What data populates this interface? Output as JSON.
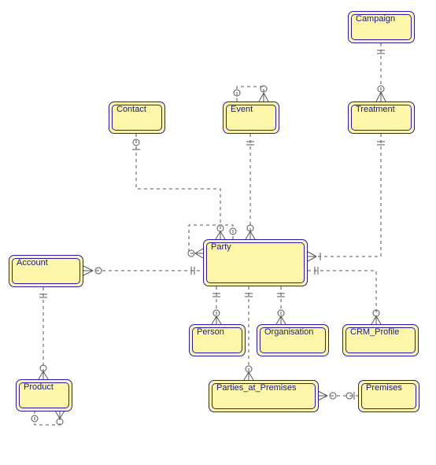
{
  "entities": {
    "campaign": {
      "label": "Campaign"
    },
    "contact": {
      "label": "Contact"
    },
    "event": {
      "label": "Event"
    },
    "treatment": {
      "label": "Treatment"
    },
    "account": {
      "label": "Account"
    },
    "party": {
      "label": "Party"
    },
    "person": {
      "label": "Person"
    },
    "organisation": {
      "label": "Organisation"
    },
    "crm_profile": {
      "label": "CRM_Profile"
    },
    "product": {
      "label": "Product"
    },
    "parties_at_premises": {
      "label": "Parties_at_Premises"
    },
    "premises": {
      "label": "Premises"
    }
  },
  "relationships": [
    {
      "from": "campaign",
      "to": "treatment",
      "type": "one-to-many"
    },
    {
      "from": "treatment",
      "to": "party",
      "type": "one-to-many"
    },
    {
      "from": "event",
      "to": "event",
      "type": "self"
    },
    {
      "from": "event",
      "to": "party",
      "type": "one-to-many"
    },
    {
      "from": "contact",
      "to": "party",
      "type": "one-to-many"
    },
    {
      "from": "account",
      "to": "party",
      "type": "many-to-one"
    },
    {
      "from": "account",
      "to": "product",
      "type": "one-to-many"
    },
    {
      "from": "product",
      "to": "product",
      "type": "self"
    },
    {
      "from": "party",
      "to": "party",
      "type": "self"
    },
    {
      "from": "party",
      "to": "person",
      "type": "one-to-many"
    },
    {
      "from": "party",
      "to": "organisation",
      "type": "one-to-many"
    },
    {
      "from": "party",
      "to": "crm_profile",
      "type": "one-to-many"
    },
    {
      "from": "party",
      "to": "parties_at_premises",
      "type": "one-to-many"
    },
    {
      "from": "parties_at_premises",
      "to": "premises",
      "type": "many-to-one"
    }
  ]
}
